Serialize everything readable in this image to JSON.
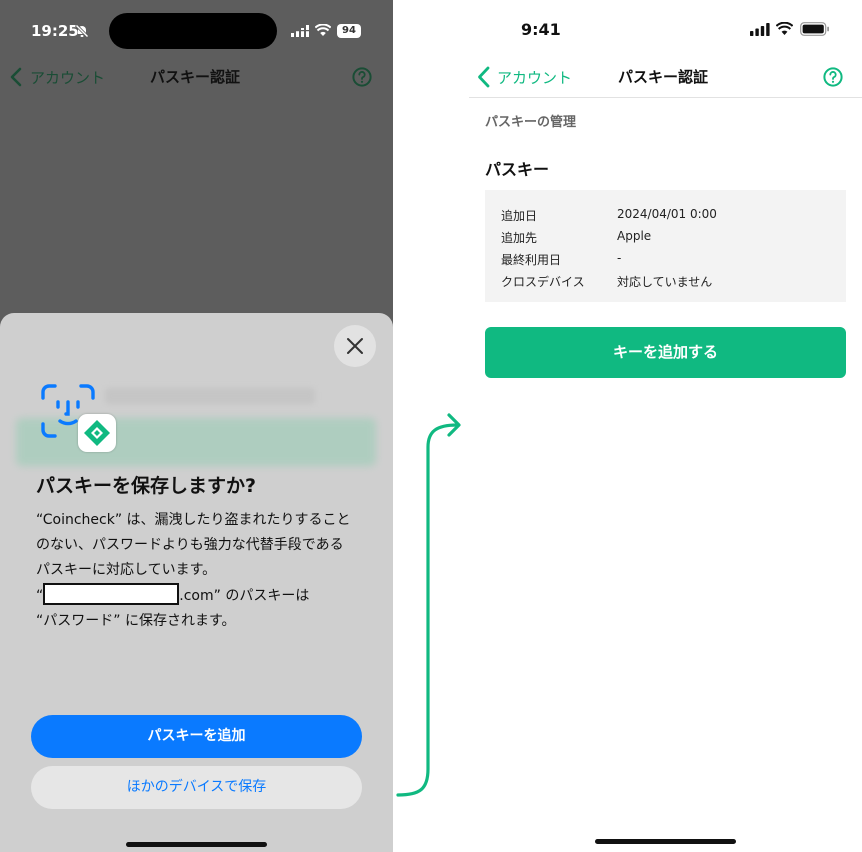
{
  "colors": {
    "accent_green": "#10b981",
    "ios_blue": "#0a7aff",
    "dimmed_background": "#5d5d5d",
    "sheet_background": "#cfcfcf"
  },
  "left_screen": {
    "status_bar": {
      "time": "19:25",
      "battery": "94",
      "icons": [
        "bell-slash-icon",
        "signal-icon",
        "wifi-icon",
        "battery-icon"
      ]
    },
    "nav": {
      "back_label": "アカウント",
      "title": "パスキー認証",
      "help_icon": "help-circle-icon"
    },
    "dialog": {
      "title": "パスキーを保存しますか?",
      "body_line1": "“Coincheck” は、漏洩したり盗まれたりすることのない、パスワードよりも強力な代替手段であるパスキーに対応しています。",
      "body_domain_open": "“",
      "body_domain_suffix": ".com” のパスキーは",
      "body_line3": "“パスワード” に保存されます。",
      "primary_button": "パスキーを追加",
      "secondary_button": "ほかのデバイスで保存",
      "icons": [
        "face-id-icon",
        "coincheck-app-icon",
        "close-icon"
      ]
    }
  },
  "right_screen": {
    "status_bar": {
      "time": "9:41",
      "icons": [
        "signal-icon",
        "wifi-icon",
        "battery-icon"
      ]
    },
    "nav": {
      "back_label": "アカウント",
      "title": "パスキー認証",
      "help_icon": "help-circle-icon"
    },
    "section_label": "パスキーの管理",
    "card_title": "パスキー",
    "details": [
      {
        "label": "追加日",
        "value": "2024/04/01 0:00"
      },
      {
        "label": "追加先",
        "value": "Apple"
      },
      {
        "label": "最終利用日",
        "value": "-"
      },
      {
        "label": "クロスデバイス",
        "value": "対応していません"
      }
    ],
    "add_button": "キーを追加する"
  }
}
